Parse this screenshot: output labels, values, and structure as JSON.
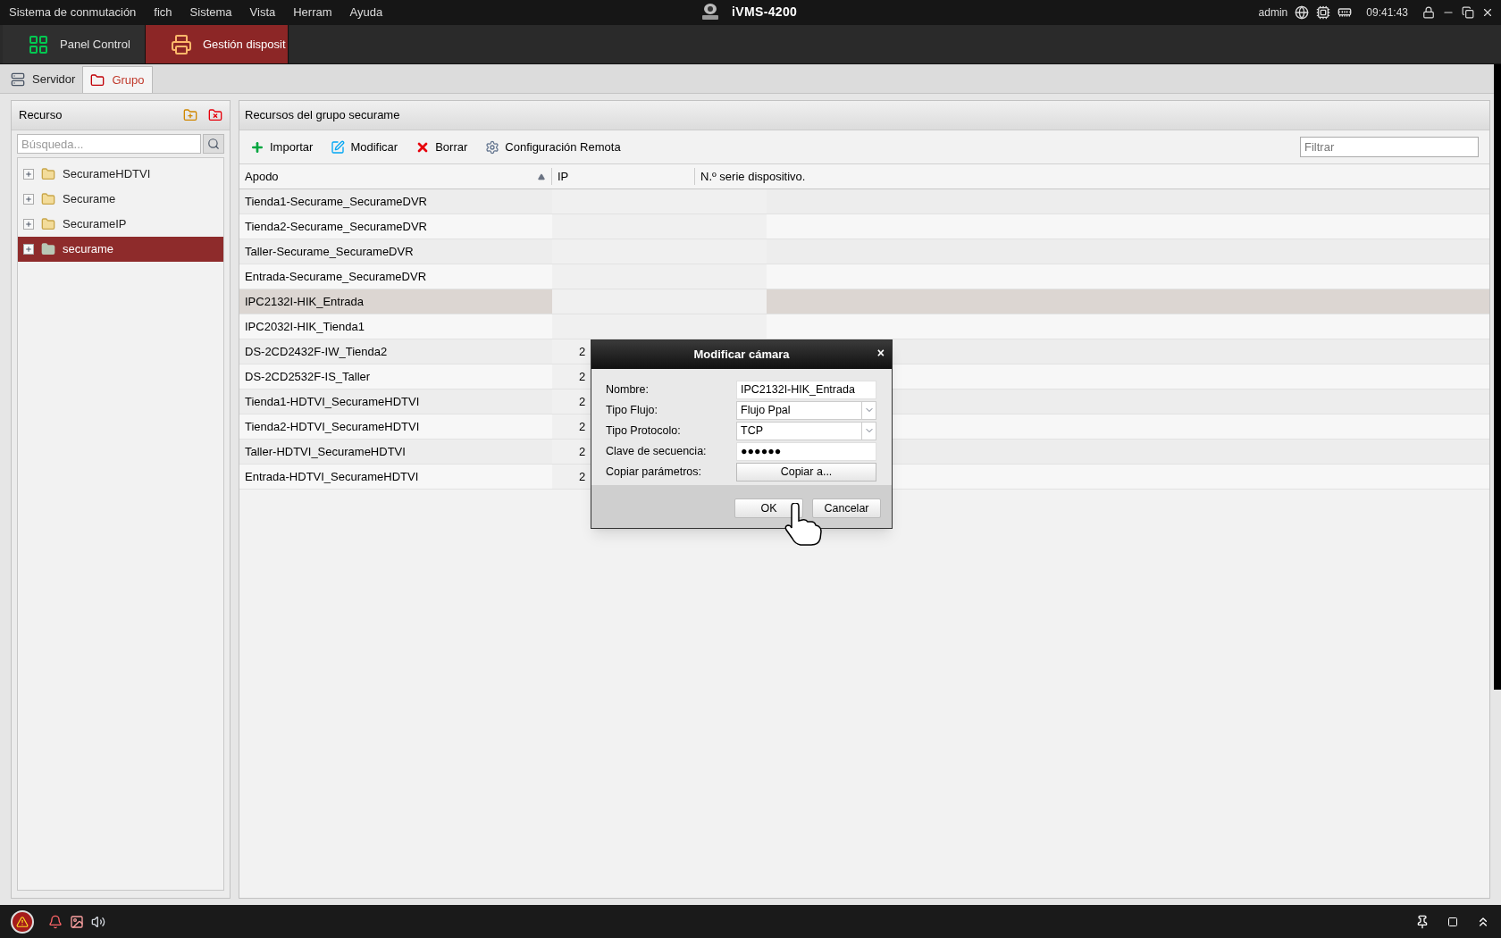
{
  "menu": [
    "Sistema de conmutación",
    "fich",
    "Sistema",
    "Vista",
    "Herram",
    "Ayuda"
  ],
  "app_title": "iVMS-4200",
  "status": {
    "user": "admin",
    "time": "09:41:43"
  },
  "main_tabs": [
    {
      "label": "Panel Control",
      "selected": false,
      "kind": "grid"
    },
    {
      "label": "Gestión disposit",
      "selected": true,
      "kind": "device"
    }
  ],
  "sub_tabs": [
    {
      "label": "Servidor",
      "selected": false,
      "kind": "server"
    },
    {
      "label": "Grupo",
      "selected": true,
      "kind": "group"
    }
  ],
  "resource_panel": {
    "title": "Recurso",
    "search_placeholder": "Búsqueda...",
    "tree": [
      {
        "label": "SecurameHDTVI",
        "selected": false
      },
      {
        "label": "Securame",
        "selected": false
      },
      {
        "label": "SecurameIP",
        "selected": false
      },
      {
        "label": "securame",
        "selected": true
      }
    ]
  },
  "group_panel": {
    "title": "Recursos del grupo securame",
    "toolbar": [
      {
        "label": "Importar",
        "kind": "add"
      },
      {
        "label": "Modificar",
        "kind": "edit"
      },
      {
        "label": "Borrar",
        "kind": "delete"
      },
      {
        "label": "Configuración Remota",
        "kind": "settings"
      }
    ],
    "filter_placeholder": "Filtrar",
    "columns": [
      "Apodo",
      "IP",
      "N.º serie dispositivo."
    ],
    "rows": [
      {
        "apodo": "Tienda1-Securame_SecurameDVR",
        "selected": false
      },
      {
        "apodo": "Tienda2-Securame_SecurameDVR",
        "selected": false
      },
      {
        "apodo": "Taller-Securame_SecurameDVR",
        "selected": false
      },
      {
        "apodo": "Entrada-Securame_SecurameDVR",
        "selected": false
      },
      {
        "apodo": "IPC2132I-HIK_Entrada",
        "selected": true
      },
      {
        "apodo": "IPC2032I-HIK_Tienda1",
        "selected": false
      },
      {
        "apodo": "DS-2CD2432F-IW_Tienda2",
        "ip": "2",
        "selected": false
      },
      {
        "apodo": "DS-2CD2532F-IS_Taller",
        "ip": "2",
        "selected": false
      },
      {
        "apodo": "Tienda1-HDTVI_SecurameHDTVI",
        "ip": "2",
        "selected": false
      },
      {
        "apodo": "Tienda2-HDTVI_SecurameHDTVI",
        "ip": "2",
        "selected": false
      },
      {
        "apodo": "Taller-HDTVI_SecurameHDTVI",
        "ip": "2",
        "selected": false
      },
      {
        "apodo": "Entrada-HDTVI_SecurameHDTVI",
        "ip": "2",
        "selected": false
      }
    ]
  },
  "dialog": {
    "title": "Modificar cámara",
    "close": "×",
    "fields": [
      {
        "label": "Nombre:",
        "kind": "text",
        "value": "IPC2132I-HIK_Entrada"
      },
      {
        "label": "Tipo Flujo:",
        "kind": "select",
        "value": "Flujo Ppal"
      },
      {
        "label": "Tipo Protocolo:",
        "kind": "select",
        "value": "TCP"
      },
      {
        "label": "Clave de secuencia:",
        "kind": "text",
        "value": "●●●●●●"
      },
      {
        "label": "Copiar parámetros:",
        "kind": "button",
        "value": "Copiar a..."
      }
    ],
    "buttons": [
      "OK",
      "Cancelar"
    ]
  }
}
